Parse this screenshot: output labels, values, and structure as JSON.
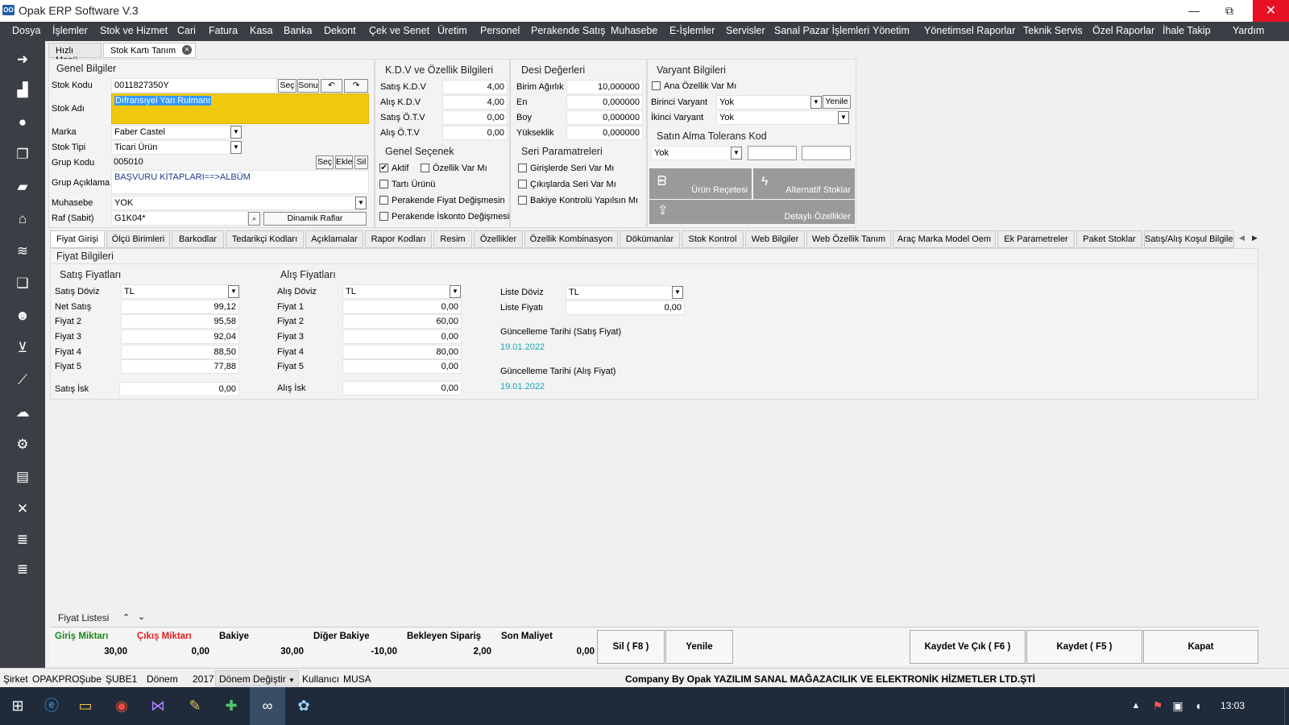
{
  "window": {
    "title": "Opak ERP Software V.3",
    "logo_text": "OO",
    "minimize": "—",
    "restore": "⧉",
    "close": "✕"
  },
  "menu": [
    "Dosya",
    "İşlemler",
    "Stok ve Hizmet",
    "Cari",
    "Fatura",
    "Kasa",
    "Banka",
    "Dekont",
    "Çek ve Senet",
    "Üretim",
    "Personel",
    "Perakende Satış",
    "Muhasebe",
    "E-İşlemler",
    "Servisler",
    "Sanal Pazar İşlemleri",
    "Yönetim",
    "Yönetimsel Raporlar",
    "Teknik Servis",
    "Özel Raporlar",
    "İhale Takip",
    "Yardım"
  ],
  "sidebar_icons": [
    "arrow-right",
    "factory",
    "user",
    "documents",
    "money",
    "bank",
    "hand-money",
    "copy",
    "person-group",
    "cart",
    "chart",
    "cloud",
    "gear",
    "doc-1",
    "tools",
    "layers",
    "layers-2"
  ],
  "tabs_top": [
    "Hızlı Menü",
    "Stok Kartı Tanım"
  ],
  "genel": {
    "header": "Genel Bilgiler",
    "stok_kodu_label": "Stok Kodu",
    "stok_kodu": "0011827350Y",
    "sec": "Seç",
    "sonu": "Sonu",
    "undo": "↶",
    "redo": "↷",
    "stok_adi_label": "Stok Adı",
    "stok_adi": "Dıfransıyel Yan Rulmanı",
    "marka_label": "Marka",
    "marka": "Faber Castel",
    "stok_tipi_label": "Stok Tipi",
    "stok_tipi": "Ticari Ürün",
    "grup_kodu_label": "Grup Kodu",
    "grup_kodu": "005010",
    "ekle": "Ekle",
    "sil": "Sil",
    "grup_aciklama_label": "Grup Açıklama",
    "grup_aciklama": "BAŞVURU KİTAPLARI==>ALBÜM",
    "muhasebe_label": "Muhasebe",
    "muhasebe": "YOK",
    "raf_label": "Raf (Sabit)",
    "raf": "G1K04*",
    "dinamik": "Dinamik Raflar"
  },
  "kdv": {
    "header": "K.D.V ve Özellik Bilgileri",
    "rows": [
      {
        "label": "Satış K.D.V",
        "value": "4,00"
      },
      {
        "label": "Alış K.D.V",
        "value": "4,00"
      },
      {
        "label": "Satış Ö.T.V",
        "value": "0,00"
      },
      {
        "label": "Alış Ö.T.V",
        "value": "0,00"
      }
    ]
  },
  "desi": {
    "header": "Desi Değerleri",
    "rows": [
      {
        "label": "Birim Ağırlık",
        "value": "10,000000"
      },
      {
        "label": "En",
        "value": "0,000000"
      },
      {
        "label": "Boy",
        "value": "0,000000"
      },
      {
        "label": "Yükseklik",
        "value": "0,000000"
      }
    ]
  },
  "varyant": {
    "header": "Varyant Bilgileri",
    "ana": "Ana Özellik Var Mı",
    "birinci_label": "Birinci Varyant",
    "birinci": "Yok",
    "yenile": "Yenile",
    "ikinci_label": "İkinci Varyant",
    "ikinci": "Yok",
    "tolerans_header": "Satın Alma Tolerans Kod",
    "tolerans": "Yok"
  },
  "genel_secenek": {
    "header": "Genel Seçenek",
    "aktif": "Aktif",
    "ozellik": "Özellik Var Mı",
    "tarti": "Tartı Ürünü",
    "perakende_fiyat": "Perakende Fiyat Değişmesin",
    "perakende_iskonto": "Perakende İskonto Değişmesin"
  },
  "seri": {
    "header": "Seri Paramatreleri",
    "giris": "Girişlerde Seri Var Mı",
    "cikis": "Çıkışlarda Seri Var Mı",
    "bakiye": "Bakiye Kontrolü Yapılsın Mı"
  },
  "tiles": {
    "urun_recetesi": "Ürün Reçetesi",
    "alternatif": "Alternatif Stoklar",
    "detayli": "Detaylı Özellikler"
  },
  "tabs2": [
    "Fiyat Girişi",
    "Ölçü Birimleri",
    "Barkodlar",
    "Tedarikçi Kodları",
    "Açıklamalar",
    "Rapor Kodları",
    "Resim",
    "Özellikler",
    "Özellik Kombinasyon",
    "Dökümanlar",
    "Stok Kontrol",
    "Web Bilgiler",
    "Web Özellik Tanım",
    "Araç Marka Model Oem",
    "Ek Parametreler",
    "Paket Stoklar",
    "Satış/Alış Koşul Bilgileri"
  ],
  "fiyat": {
    "header": "Fiyat Bilgileri",
    "satis_header": "Satış Fiyatları",
    "alis_header": "Alış Fiyatları",
    "satis_doviz_label": "Satış Döviz",
    "satis_doviz": "TL",
    "alis_doviz_label": "Alış Döviz",
    "alis_doviz": "TL",
    "satis_rows": [
      {
        "label": "Net Satış",
        "value": "99,12"
      },
      {
        "label": "Fiyat 2",
        "value": "95,58"
      },
      {
        "label": "Fiyat 3",
        "value": "92,04"
      },
      {
        "label": "Fiyat 4",
        "value": "88,50"
      },
      {
        "label": "Fiyat 5",
        "value": "77,88"
      }
    ],
    "alis_rows": [
      {
        "label": "Fiyat 1",
        "value": "0,00"
      },
      {
        "label": "Fiyat 2",
        "value": "60,00"
      },
      {
        "label": "Fiyat 3",
        "value": "0,00"
      },
      {
        "label": "Fiyat 4",
        "value": "80,00"
      },
      {
        "label": "Fiyat 5",
        "value": "0,00"
      }
    ],
    "satis_isk_label": "Satış İsk",
    "satis_isk": "0,00",
    "alis_isk_label": "Alış İsk",
    "alis_isk": "0,00",
    "liste_doviz_label": "Liste  Döviz",
    "liste_doviz": "TL",
    "liste_fiyati_label": "Liste Fiyatı",
    "liste_fiyati": "0,00",
    "guncel_satis_label": "Güncelleme Tarihi (Satış Fiyat)",
    "guncel_satis": "19.01.2022",
    "guncel_alis_label": "Güncelleme Tarihi (Alış Fiyat)",
    "guncel_alis": "19.01.2022",
    "fiyat_listesi": "Fiyat Listesi"
  },
  "summary": {
    "giris_label": "Giriş Miktarı",
    "giris": "30,00",
    "cikis_label": "Çıkış Miktarı",
    "cikis": "0,00",
    "bakiye_label": "Bakiye",
    "bakiye": "30,00",
    "diger_label": "Diğer Bakiye",
    "diger": "-10,00",
    "bekleyen_label": "Bekleyen Sipariş",
    "bekleyen": "2,00",
    "maliyet_label": "Son Maliyet",
    "maliyet": "0,00"
  },
  "actions": {
    "sil": "Sil ( F8 )",
    "yenile": "Yenile",
    "kaydet_cik": "Kaydet Ve Çık ( F6 )",
    "kaydet": "Kaydet ( F5 )",
    "kapat": "Kapat"
  },
  "status": {
    "sirket_label": "Şirket",
    "sirket": "OPAKPRO",
    "sube_label": "Şube",
    "sube": "ŞUBE1",
    "donem_label": "Dönem",
    "donem": "2017",
    "donem_degistir": "Dönem Değiştir",
    "kullanici_label": "Kullanıcı",
    "kullanici": "MUSA",
    "company": "Company By Opak YAZILIM SANAL MAĞAZACILIK VE ELEKTRONİK HİZMETLER LTD.ŞTİ"
  },
  "taskbar": {
    "time": "13:03"
  },
  "colors": {
    "menu_bg": "#3b3f45",
    "highlight": "#f0c90f",
    "date": "#1aa5b5",
    "giris": "#1a8a1a",
    "cikis": "#e02020"
  }
}
